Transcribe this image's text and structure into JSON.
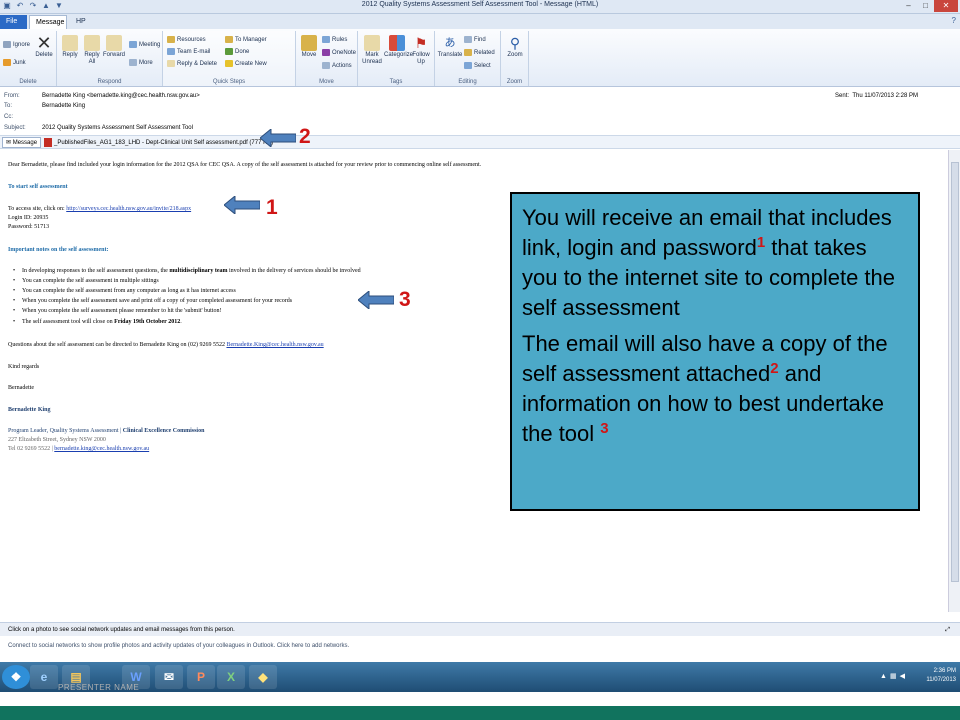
{
  "window": {
    "title": "2012 Quality Systems Assessment Self Assessment Tool - Message (HTML)"
  },
  "tabs": {
    "file": "File",
    "message": "Message",
    "hp_trim": "HP TRIM"
  },
  "ribbon": {
    "delete_group": {
      "label": "Delete",
      "ignore": "Ignore",
      "junk": "Junk",
      "delete": "Delete"
    },
    "respond_group": {
      "label": "Respond",
      "reply": "Reply",
      "reply_all": "Reply All",
      "forward": "Forward",
      "meeting": "Meeting",
      "more": "More"
    },
    "quick_steps": {
      "label": "Quick Steps",
      "items": [
        "Resources",
        "Team E-mail",
        "Reply & Delete",
        "To Manager",
        "Done",
        "Create New"
      ]
    },
    "move_group": {
      "label": "Move",
      "move": "Move",
      "rules": "Rules",
      "onenote": "OneNote",
      "actions": "Actions"
    },
    "tags_group": {
      "label": "Tags",
      "mark_unread": "Mark Unread",
      "categorize": "Categorize",
      "follow_up": "Follow Up"
    },
    "editing_group": {
      "label": "Editing",
      "translate": "Translate",
      "find": "Find",
      "related": "Related",
      "select": "Select"
    },
    "zoom_group": {
      "label": "Zoom",
      "zoom": "Zoom"
    }
  },
  "header": {
    "from_label": "From:",
    "from": "Bernadette King <bernadette.king@cec.health.nsw.gov.au>",
    "to_label": "To:",
    "to": "Bernadette King",
    "cc_label": "Cc:",
    "subject_label": "Subject:",
    "subject": "2012 Quality Systems Assessment Self Assessment Tool",
    "sent_label": "Sent:",
    "sent": "Thu 11/07/2013 2:28 PM"
  },
  "attachments": {
    "message_tab": "Message",
    "file": "_PublishedFiles_AG1_183_LHD - Dept-Clinical Unit Self assessment.pdf (777 KB)"
  },
  "body": {
    "greeting": "Dear Bernadette, please find included your login information for the 2012 QSA for CEC QSA. A copy of the self assessment is attached for your review prior to commencing online self assessment.",
    "start_heading": "To start self assessment",
    "access_text": "To access site, click on: ",
    "access_link": "http://surveys.cec.health.nsw.gov.au/invite/218.aspx",
    "login": "Login ID: 20935",
    "password": "Password:   51713",
    "notes_heading": "Important notes on the self assessment:",
    "bullets": [
      {
        "before": "In developing responses to the self assessment questions, the ",
        "bold": "multidisciplinary team",
        "after": " involved in the delivery of services should be involved"
      },
      {
        "before": "You can complete the self assessment in multiple sittings",
        "bold": "",
        "after": ""
      },
      {
        "before": "You can complete the self assessment from any computer as long as it has internet access",
        "bold": "",
        "after": ""
      },
      {
        "before": "When you complete the self assessment save and print off a copy of your completed assessment for your records",
        "bold": "",
        "after": ""
      },
      {
        "before": "When you complete the self assessment please remember to hit the 'submit' button!",
        "bold": "",
        "after": ""
      },
      {
        "before": "The self assessment tool will close on ",
        "bold": "Friday 19th October 2012",
        "after": "."
      }
    ],
    "questions_text": "Questions about the self assessment can be directed to Bernadette King on (02) 9269 5522 ",
    "questions_link": "Bernadette.King@cec.health.nsw.gov.au",
    "kind_regards": "Kind regards",
    "first_name": "Bernadette",
    "signature_name": "Bernadette King",
    "signature_title_a": "Program Leader, Quality Systems Assessment | ",
    "signature_title_b": "Clinical Excellence Commission",
    "signature_address": "227 Elizabeth Street, Sydney NSW 2000",
    "signature_tel": "Tel 02 9269 5522 | ",
    "signature_email": "bernadette.king@cec.health.nsw.gov.au"
  },
  "social": {
    "pane_text": "Click on a photo to see social network updates and email messages from this person.",
    "connect_text": "Connect to social networks to show profile photos and activity updates of your colleagues in Outlook. Click here to add networks."
  },
  "presenter": "PRESENTER NAME",
  "taskbar": {
    "time": "2:36 PM",
    "date": "11/07/2013"
  },
  "callout": {
    "p1_a": "You will receive an email that includes link, login and password",
    "p1_sup": "1",
    "p1_b": " that takes you to the internet site to complete the self assessment",
    "p2_a": "The email will also have a copy of the self assessment attached",
    "p2_sup": "2",
    "p2_b": " and information on how to best undertake the tool ",
    "p2_sup2": "3"
  },
  "markers": {
    "m1": "1",
    "m2": "2",
    "m3": "3"
  },
  "colors": {
    "callout_bg": "#4ca9c8",
    "marker_red": "#d01616",
    "arrow_blue": "#4f81bd",
    "file_tab": "#2b6ac6",
    "taskbar": "#1f4d74",
    "footer_green": "#11735e"
  }
}
